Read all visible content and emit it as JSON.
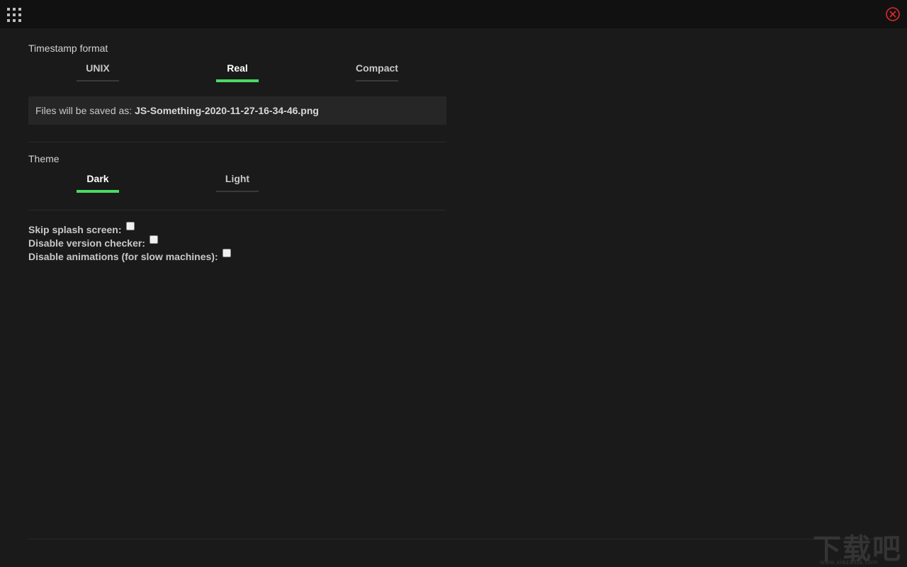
{
  "header": {
    "menu_icon": "grid-menu-icon",
    "close_icon": "close-circle-icon",
    "close_color": "#e0292b"
  },
  "timestamp": {
    "label": "Timestamp format",
    "tabs": [
      {
        "label": "UNIX",
        "active": false
      },
      {
        "label": "Real",
        "active": true
      },
      {
        "label": "Compact",
        "active": false
      }
    ],
    "saved_prefix": "Files will be saved as:",
    "saved_filename": "JS-Something-2020-11-27-16-34-46.png"
  },
  "theme": {
    "label": "Theme",
    "tabs": [
      {
        "label": "Dark",
        "active": true
      },
      {
        "label": "Light",
        "active": false
      }
    ]
  },
  "options": [
    {
      "label": "Skip splash screen:",
      "checked": false
    },
    {
      "label": "Disable version checker:",
      "checked": false
    },
    {
      "label": "Disable animations (for slow machines):",
      "checked": false
    }
  ],
  "accent_color": "#4cd964",
  "watermark": {
    "main": "下载吧",
    "sub": "www.xiazaiba.com"
  }
}
